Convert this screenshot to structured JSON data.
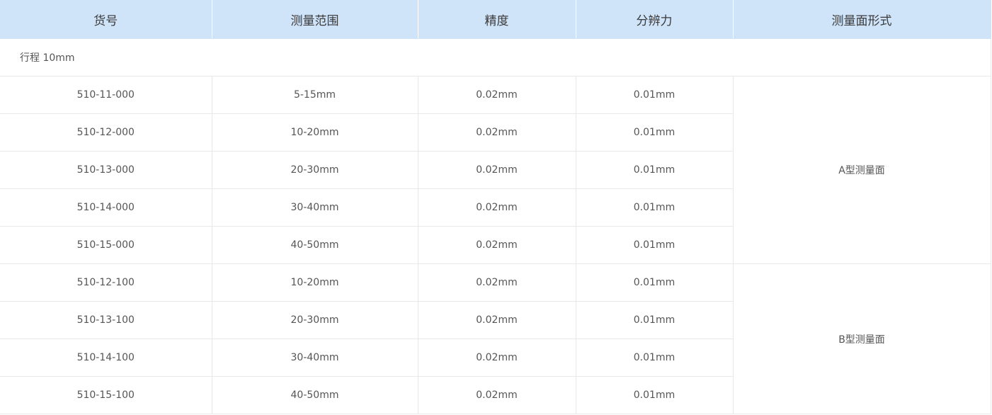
{
  "headers": [
    "货号",
    "测量范围",
    "精度",
    "分辨力",
    "测量面形式"
  ],
  "group": {
    "label": "行程 10mm"
  },
  "rows": [
    {
      "code": "510-11-000",
      "range": "5-15mm",
      "accuracy": "0.02mm",
      "resolution": "0.01mm"
    },
    {
      "code": "510-12-000",
      "range": "10-20mm",
      "accuracy": "0.02mm",
      "resolution": "0.01mm"
    },
    {
      "code": "510-13-000",
      "range": "20-30mm",
      "accuracy": "0.02mm",
      "resolution": "0.01mm"
    },
    {
      "code": "510-14-000",
      "range": "30-40mm",
      "accuracy": "0.02mm",
      "resolution": "0.01mm"
    },
    {
      "code": "510-15-000",
      "range": "40-50mm",
      "accuracy": "0.02mm",
      "resolution": "0.01mm"
    },
    {
      "code": "510-12-100",
      "range": "10-20mm",
      "accuracy": "0.02mm",
      "resolution": "0.01mm"
    },
    {
      "code": "510-13-100",
      "range": "20-30mm",
      "accuracy": "0.02mm",
      "resolution": "0.01mm"
    },
    {
      "code": "510-14-100",
      "range": "30-40mm",
      "accuracy": "0.02mm",
      "resolution": "0.01mm"
    },
    {
      "code": "510-15-100",
      "range": "40-50mm",
      "accuracy": "0.02mm",
      "resolution": "0.01mm"
    }
  ],
  "faces": [
    "A型测量面",
    "B型测量面"
  ],
  "colors": {
    "header_bg": "#cfe3f9",
    "border": "#e8e8e8",
    "text": "#555555"
  }
}
